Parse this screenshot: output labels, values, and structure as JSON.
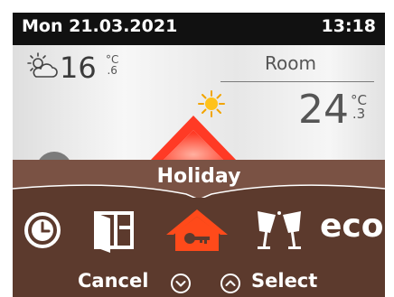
{
  "status_bar": {
    "date": "Mon  21.03.2021",
    "time": "13:18"
  },
  "weather": {
    "icon": "sun-cloud-icon",
    "outside_temp": "16",
    "outside_unit": "°C",
    "outside_decimal": ".6"
  },
  "room": {
    "label": "Room",
    "temp": "24",
    "unit": "°C",
    "decimal": ".3"
  },
  "menu": {
    "title": "Holiday",
    "modes": [
      {
        "name": "clock-icon",
        "label": ""
      },
      {
        "name": "window-icon",
        "label": ""
      },
      {
        "name": "holiday-house-key-icon",
        "label": ""
      },
      {
        "name": "party-glasses-icon",
        "label": ""
      },
      {
        "name": "eco",
        "label": "eco"
      }
    ],
    "cancel_label": "Cancel",
    "select_label": "Select"
  },
  "colors": {
    "menu_background": "#5c3a2d",
    "active_icon": "#ff4a1a",
    "inactive_icon": "#ffffff",
    "status_bar": "#111111"
  }
}
